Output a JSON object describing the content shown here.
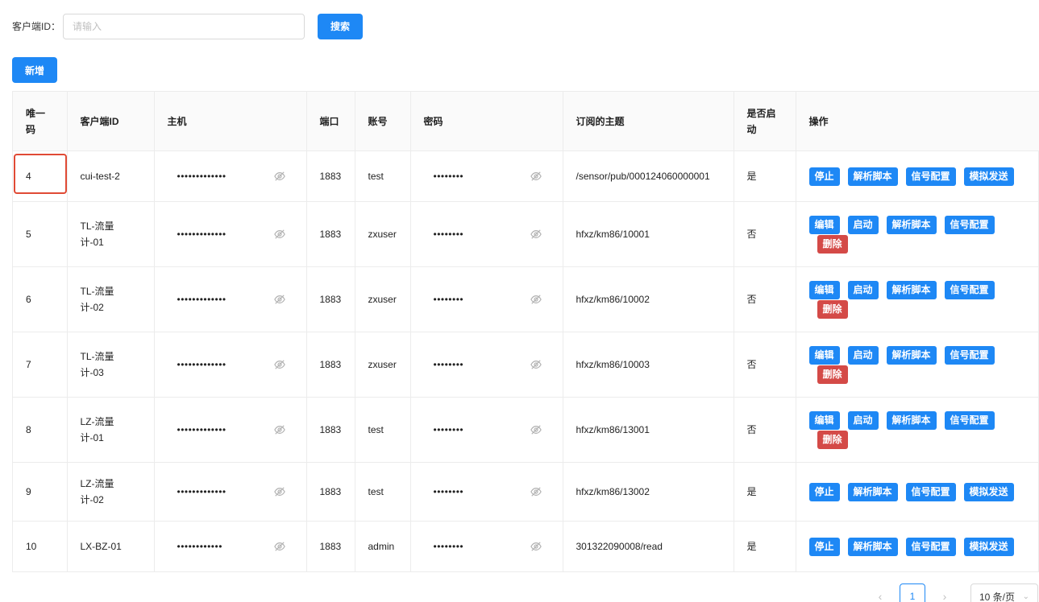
{
  "search": {
    "label": "客户端ID：",
    "placeholder": "请输入",
    "value": "",
    "button": "搜索"
  },
  "add_button": "新增",
  "table": {
    "columns": [
      "唯一码",
      "客户端ID",
      "主机",
      "端口",
      "账号",
      "密码",
      "订阅的主题",
      "是否启动",
      "操作"
    ],
    "rows": [
      {
        "id": "4",
        "client": "cui-test-2",
        "host": "•••••••••••••",
        "port": "1883",
        "account": "test",
        "password": "••••••••",
        "topic": "/sensor/pub/000124060000001",
        "enabled": "是",
        "actions": [
          "停止",
          "解析脚本",
          "信号配置",
          "模拟发送"
        ]
      },
      {
        "id": "5",
        "client": "TL-流量计-01",
        "host": "•••••••••••••",
        "port": "1883",
        "account": "zxuser",
        "password": "••••••••",
        "topic": "hfxz/km86/10001",
        "enabled": "否",
        "actions": [
          "编辑",
          "启动",
          "解析脚本",
          "信号配置",
          "删除"
        ]
      },
      {
        "id": "6",
        "client": "TL-流量计-02",
        "host": "•••••••••••••",
        "port": "1883",
        "account": "zxuser",
        "password": "••••••••",
        "topic": "hfxz/km86/10002",
        "enabled": "否",
        "actions": [
          "编辑",
          "启动",
          "解析脚本",
          "信号配置",
          "删除"
        ]
      },
      {
        "id": "7",
        "client": "TL-流量计-03",
        "host": "•••••••••••••",
        "port": "1883",
        "account": "zxuser",
        "password": "••••••••",
        "topic": "hfxz/km86/10003",
        "enabled": "否",
        "actions": [
          "编辑",
          "启动",
          "解析脚本",
          "信号配置",
          "删除"
        ]
      },
      {
        "id": "8",
        "client": "LZ-流量计-01",
        "host": "•••••••••••••",
        "port": "1883",
        "account": "test",
        "password": "••••••••",
        "topic": "hfxz/km86/13001",
        "enabled": "否",
        "actions": [
          "编辑",
          "启动",
          "解析脚本",
          "信号配置",
          "删除"
        ]
      },
      {
        "id": "9",
        "client": "LZ-流量计-02",
        "host": "•••••••••••••",
        "port": "1883",
        "account": "test",
        "password": "••••••••",
        "topic": "hfxz/km86/13002",
        "enabled": "是",
        "actions": [
          "停止",
          "解析脚本",
          "信号配置",
          "模拟发送"
        ]
      },
      {
        "id": "10",
        "client": "LX-BZ-01",
        "host": "••••••••••••",
        "port": "1883",
        "account": "admin",
        "password": "••••••••",
        "topic": "301322090008/read",
        "enabled": "是",
        "actions": [
          "停止",
          "解析脚本",
          "信号配置",
          "模拟发送"
        ]
      }
    ]
  },
  "pagination": {
    "prev_icon": "chevron-left-icon",
    "prev": "‹",
    "current_page": "1",
    "next_icon": "chevron-right-icon",
    "next": "›",
    "page_size": "10 条/页"
  },
  "colors": {
    "primary": "#1e88f5",
    "danger": "#d44a47",
    "highlight": "#e04a35"
  }
}
